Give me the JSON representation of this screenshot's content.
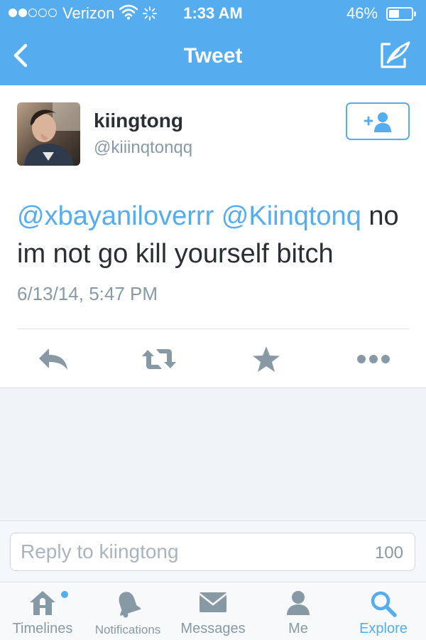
{
  "status_bar": {
    "carrier": "Verizon",
    "time": "1:33 AM",
    "battery": "46%",
    "battery_level": 0.46,
    "signal_bars_filled": 2,
    "signal_bars_total": 5
  },
  "nav": {
    "title": "Tweet",
    "back_icon": "chevron-left-icon",
    "compose_icon": "compose-tweet-icon"
  },
  "tweet": {
    "display_name": "kiingtong",
    "handle": "@kiiinqtonqq",
    "mention_1": "@xbayaniloverrr",
    "mention_2": "@Kiinqtonq",
    "body": "no im not go kill yourself bitch",
    "timestamp": "6/13/14, 5:47 PM",
    "follow_icon": "follow-user-icon"
  },
  "actions": [
    {
      "name": "reply",
      "icon": "reply-icon"
    },
    {
      "name": "retweet",
      "icon": "retweet-icon"
    },
    {
      "name": "favorite",
      "icon": "star-icon"
    },
    {
      "name": "more",
      "icon": "more-icon"
    }
  ],
  "reply": {
    "placeholder": "Reply to kiingtong",
    "char_count": "100"
  },
  "tabs": [
    {
      "label": "Timelines",
      "icon": "home-icon",
      "active": false,
      "has_badge": true
    },
    {
      "label": "Notifications",
      "icon": "bell-icon",
      "active": false
    },
    {
      "label": "Messages",
      "icon": "envelope-icon",
      "active": false
    },
    {
      "label": "Me",
      "icon": "person-icon",
      "active": false
    },
    {
      "label": "Explore",
      "icon": "search-icon",
      "active": true
    }
  ],
  "colors": {
    "brand": "#55acee",
    "text": "#292f33",
    "muted": "#8899a6",
    "icon_gray": "#8899a6"
  }
}
